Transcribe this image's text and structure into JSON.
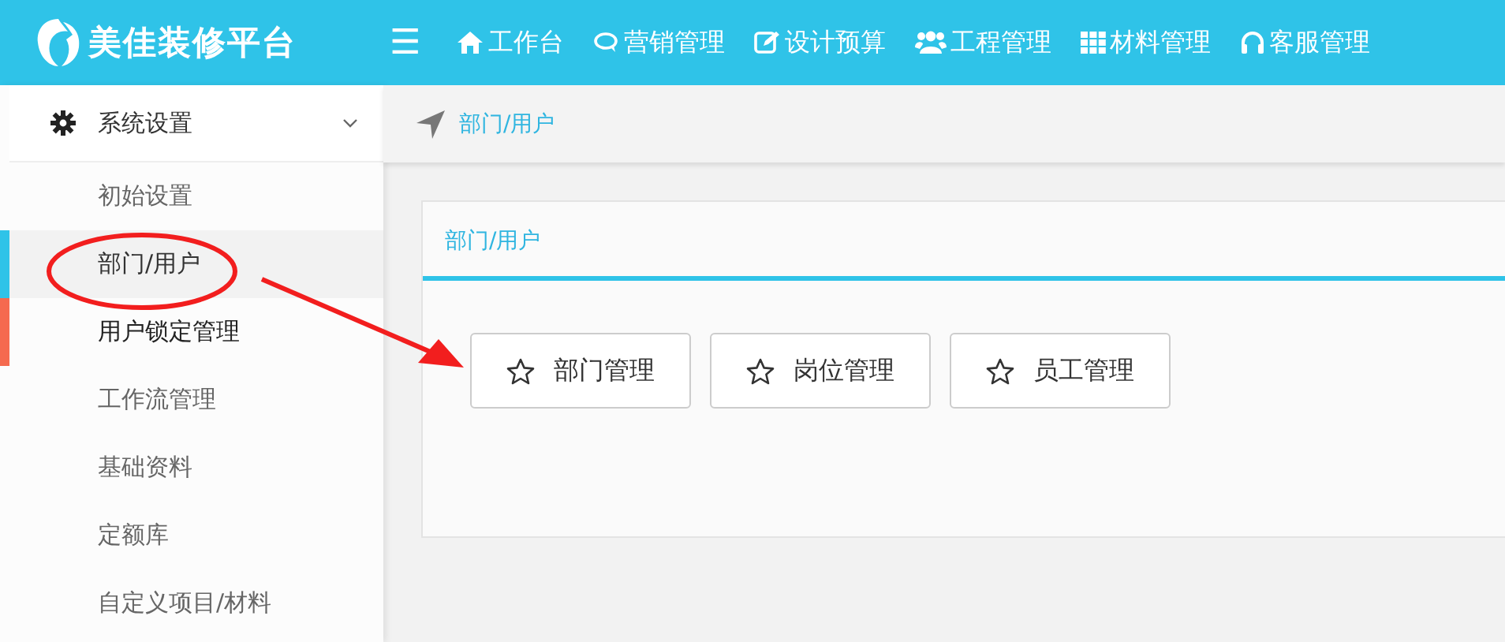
{
  "header": {
    "brand": "美佳装修平台",
    "menu_icon": "☰",
    "nav": [
      {
        "label": "工作台"
      },
      {
        "label": "营销管理"
      },
      {
        "label": "设计预算"
      },
      {
        "label": "工程管理"
      },
      {
        "label": "材料管理"
      },
      {
        "label": "客服管理"
      }
    ]
  },
  "sidebar": {
    "section": {
      "label": "系统设置",
      "expanded": true
    },
    "items": [
      {
        "label": "初始设置",
        "selected": false,
        "hovered": false
      },
      {
        "label": "部门/用户",
        "selected": true,
        "hovered": false
      },
      {
        "label": "用户锁定管理",
        "selected": false,
        "hovered": true
      },
      {
        "label": "工作流管理",
        "selected": false,
        "hovered": false
      },
      {
        "label": "基础资料",
        "selected": false,
        "hovered": false
      },
      {
        "label": "定额库",
        "selected": false,
        "hovered": false
      },
      {
        "label": "自定义项目/材料",
        "selected": false,
        "hovered": false
      }
    ]
  },
  "breadcrumb": "部门/用户",
  "panel": {
    "title": "部门/用户",
    "buttons": [
      {
        "label": "部门管理"
      },
      {
        "label": "岗位管理"
      },
      {
        "label": "员工管理"
      }
    ]
  }
}
